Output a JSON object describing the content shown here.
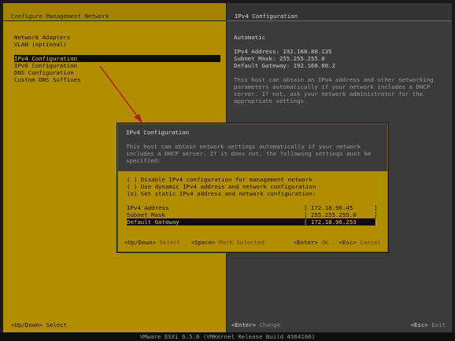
{
  "left": {
    "title": "Configure Management Network",
    "menu": [
      {
        "label": "Network Adapters"
      },
      {
        "label": "VLAN (optional)"
      },
      {
        "label": "IPv4 Configuration",
        "selected": true
      },
      {
        "label": "IPv6 Configuration"
      },
      {
        "label": "DNS Configuration"
      },
      {
        "label": "Custom DNS Suffixes"
      }
    ],
    "footer_key": "<Up/Down>",
    "footer_action": "Select"
  },
  "right": {
    "title": "IPv4 Configuration",
    "mode": "Automatic",
    "ipv4_line": "IPv4 Address: 192.168.80.135",
    "subnet_line": "Subnet Mask: 255.255.255.0",
    "gateway_line": "Default Gateway: 192.168.80.2",
    "help": [
      "This host can obtain an IPv4 address and other networking",
      "parameters automatically if your network includes a DHCP",
      "server. If not, ask your network administrator for the",
      "appropriate settings."
    ],
    "footer_left_key": "<Enter>",
    "footer_left_action": "Change",
    "footer_right_key": "<Esc>",
    "footer_right_action": "Exit"
  },
  "dialog": {
    "title": "IPv4 Configuration",
    "note": [
      "This host can obtain network settings automatically if your network",
      "includes a DHCP server. If it does not, the following settings must be",
      "specified:"
    ],
    "options": [
      "( ) Disable IPv4 configuration for management network",
      "( ) Use dynamic IPv4 address and network configuration",
      "(o) Set static IPv4 address and network configuration:"
    ],
    "fields": [
      {
        "label": "IPv4 Address",
        "value": "[ 172.18.96.45      ]"
      },
      {
        "label": "Subnet Mask",
        "value": "[ 255.255.255.0     ]"
      },
      {
        "label": "Default Gateway",
        "value": "[ 172.18.96.253     ]",
        "selected": true
      }
    ],
    "footer": {
      "k1": "<Up/Down>",
      "a1": "Select",
      "k2": "<Space>",
      "a2": "Mark Selected",
      "k3": "<Enter>",
      "a3": "OK",
      "k4": "<Esc>",
      "a4": "Cancel"
    }
  },
  "status_bar": "VMware ESXi 6.5.0 (VMKernel Release Build 4564106)",
  "colors": {
    "accent": "#b38d00",
    "panel_dark": "#3b3b3b",
    "arrow": "#b01e1e"
  }
}
